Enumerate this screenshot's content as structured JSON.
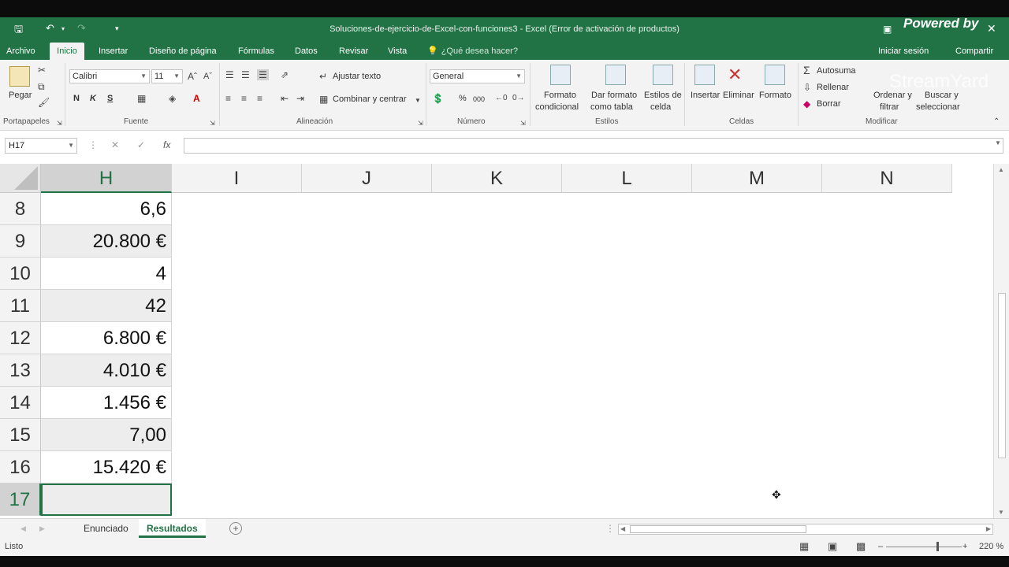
{
  "window": {
    "title": "Soluciones-de-ejercicio-de-Excel-con-funciones3 - Excel (Error de activación de productos)"
  },
  "tabs": [
    "Archivo",
    "Inicio",
    "Insertar",
    "Diseño de página",
    "Fórmulas",
    "Datos",
    "Revisar",
    "Vista"
  ],
  "tell_me": "¿Qué desea hacer?",
  "signin": "Iniciar sesión",
  "share": "Compartir",
  "ribbon": {
    "clipboard": {
      "paste": "Pegar",
      "group": "Portapapeles"
    },
    "font": {
      "name": "Calibri",
      "size": "11",
      "bold": "N",
      "italic": "K",
      "underline": "S",
      "group": "Fuente"
    },
    "alignment": {
      "wrap": "Ajustar texto",
      "merge": "Combinar y centrar",
      "group": "Alineación"
    },
    "number": {
      "format": "General",
      "group": "Número"
    },
    "styles": {
      "cond_l1": "Formato",
      "cond_l2": "condicional",
      "table_l1": "Dar formato",
      "table_l2": "como tabla",
      "cell_l1": "Estilos de",
      "cell_l2": "celda",
      "group": "Estilos"
    },
    "cells": {
      "insert": "Insertar",
      "delete": "Eliminar",
      "format": "Formato",
      "group": "Celdas"
    },
    "editing": {
      "autosum": "Autosuma",
      "fill": "Rellenar",
      "clear": "Borrar",
      "sort_l1": "Ordenar y",
      "sort_l2": "filtrar",
      "find_l1": "Buscar y",
      "find_l2": "seleccionar",
      "group": "Modificar"
    }
  },
  "formula_bar": {
    "name_box": "H17",
    "fx": "fx",
    "value": ""
  },
  "columns": [
    "H",
    "I",
    "J",
    "K",
    "L",
    "M",
    "N"
  ],
  "rows": [
    {
      "num": "8",
      "value": "6,6"
    },
    {
      "num": "9",
      "value": "20.800 €"
    },
    {
      "num": "10",
      "value": "4"
    },
    {
      "num": "11",
      "value": "42"
    },
    {
      "num": "12",
      "value": "6.800 €"
    },
    {
      "num": "13",
      "value": "4.010 €"
    },
    {
      "num": "14",
      "value": "1.456 €"
    },
    {
      "num": "15",
      "value": "7,00"
    },
    {
      "num": "16",
      "value": "15.420 €"
    },
    {
      "num": "17",
      "value": ""
    }
  ],
  "sheets": [
    "Enunciado",
    "Resultados"
  ],
  "status": {
    "ready": "Listo",
    "zoom": "220 %"
  },
  "overlay": {
    "powered": "Powered by",
    "brand": "StreamYard"
  },
  "colors": {
    "excel_green": "#217346"
  }
}
